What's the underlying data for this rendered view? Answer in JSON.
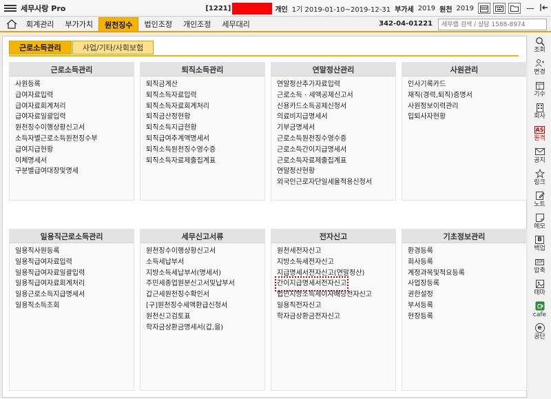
{
  "titlebar": {
    "app_title": "세무사랑 Pro",
    "company_code": "[1221]",
    "entity_type": "개인",
    "period": "1기 2019-01-10~2019-12-31",
    "vat_label": "부가세",
    "vat_year": "2019",
    "withholding_label": "원천",
    "withholding_year": "2019"
  },
  "menubar": {
    "items": [
      "회계관리",
      "부가가치",
      "원천징수",
      "법인조정",
      "개인조정",
      "세무대리"
    ],
    "active_index": 2,
    "business_number": "342-04-01221",
    "search_placeholder": "세무랩 검색 / 상담 1588-8974"
  },
  "subtabs": [
    "근로소득관리",
    "사업/기타/사회보험"
  ],
  "panels": [
    {
      "title": "근로소득관리",
      "links": [
        "사원등록",
        "급여자료입력",
        "급여자료회계처리",
        "급여자료일괄입력",
        "원천징수이행상황신고서",
        "소득자별근로소득원천징수부",
        "급여지급현황",
        "이체명세서",
        "구분별급여대장및명세"
      ]
    },
    {
      "title": "퇴직소득관리",
      "links": [
        "퇴직금계산",
        "퇴직소득자료입력",
        "퇴직소득자료회계처리",
        "퇴직금산정현황",
        "퇴직소득지급현황",
        "퇴직급여추계액명세서",
        "퇴직소득원천징수영수증",
        "퇴직소득자료제출집계표"
      ]
    },
    {
      "title": "연말정산관리",
      "links": [
        "연말정산추가자료입력",
        "근로소득 · 세액공제신고서",
        "신용카드소득공제신청서",
        "의료비지급명세서",
        "기부금명세서",
        "근로소득원천징수영수증",
        "근로소득간이지급명세서",
        "근로소득자료제출집계표",
        "연말정산현황",
        "외국인근로자단일세율적용신청서"
      ]
    },
    {
      "title": "사원관리",
      "links": [
        "인사기록카드",
        "재직(경력,퇴직)증명서",
        "사원정보이력관리",
        "입퇴사자현황"
      ]
    },
    {
      "title": "일용직근로소득관리",
      "links": [
        "일용직사원등록",
        "일용직급여자료입력",
        "일용직급여자료일괄입력",
        "일용직급여자료회계처리",
        "일용근로소득지급명세서",
        "일용직소득조회"
      ]
    },
    {
      "title": "세무신고서류",
      "links": [
        "원천징수이행상황신고서",
        "소득세납부서",
        "지방소득세납부서(명세서)",
        "주민세종업원분신고서및납부서",
        "갑근세원천징수확인서",
        "[구]원천징수세액환급신청서",
        "원천신고검토표",
        "학자금상환금명세서(갑,을)"
      ]
    },
    {
      "title": "전자신고",
      "links": [
        "원천세전자신고",
        "지방소득세전자신고",
        "지급명세서전자신고(연말정산)",
        "간이지급명세서전자신고",
        "법인지방소득세이자배당전자신고",
        "일용직전자신고",
        "학자금상환금전자신고"
      ]
    },
    {
      "title": "기초정보관리",
      "links": [
        "환경등록",
        "회사등록",
        "계정과목및적요등록",
        "사업장등록",
        "권한설정",
        "부서등록",
        "현장등록"
      ]
    }
  ],
  "highlighted_link": "간이지급명세서전자신고",
  "sidebar": [
    {
      "icon": "search-icon",
      "label": "조회"
    },
    {
      "icon": "change-icon",
      "label": "변경"
    },
    {
      "icon": "period-icon",
      "label": "기수"
    },
    {
      "icon": "company-icon",
      "label": "회사"
    },
    {
      "icon": "as-remote-icon",
      "label": "원격",
      "badge": "AS"
    },
    {
      "icon": "mail-icon",
      "label": "공지"
    },
    {
      "icon": "star-icon",
      "label": "링크"
    },
    {
      "icon": "note-icon",
      "label": "노트"
    },
    {
      "icon": "memo-icon",
      "label": "메모"
    },
    {
      "icon": "backup-icon",
      "label": "백업",
      "badge": "B"
    },
    {
      "icon": "zip-icon",
      "label": "압축",
      "badge": "ZIP"
    },
    {
      "icon": "theme-icon",
      "label": "테마"
    },
    {
      "icon": "cafe-icon",
      "label": "cafe"
    },
    {
      "icon": "ebuilding-icon",
      "label": "공단",
      "badge": "e"
    }
  ],
  "colors": {
    "accent": "#f5b400",
    "highlight_border": "#d40000",
    "redacted": "#ff0000"
  }
}
